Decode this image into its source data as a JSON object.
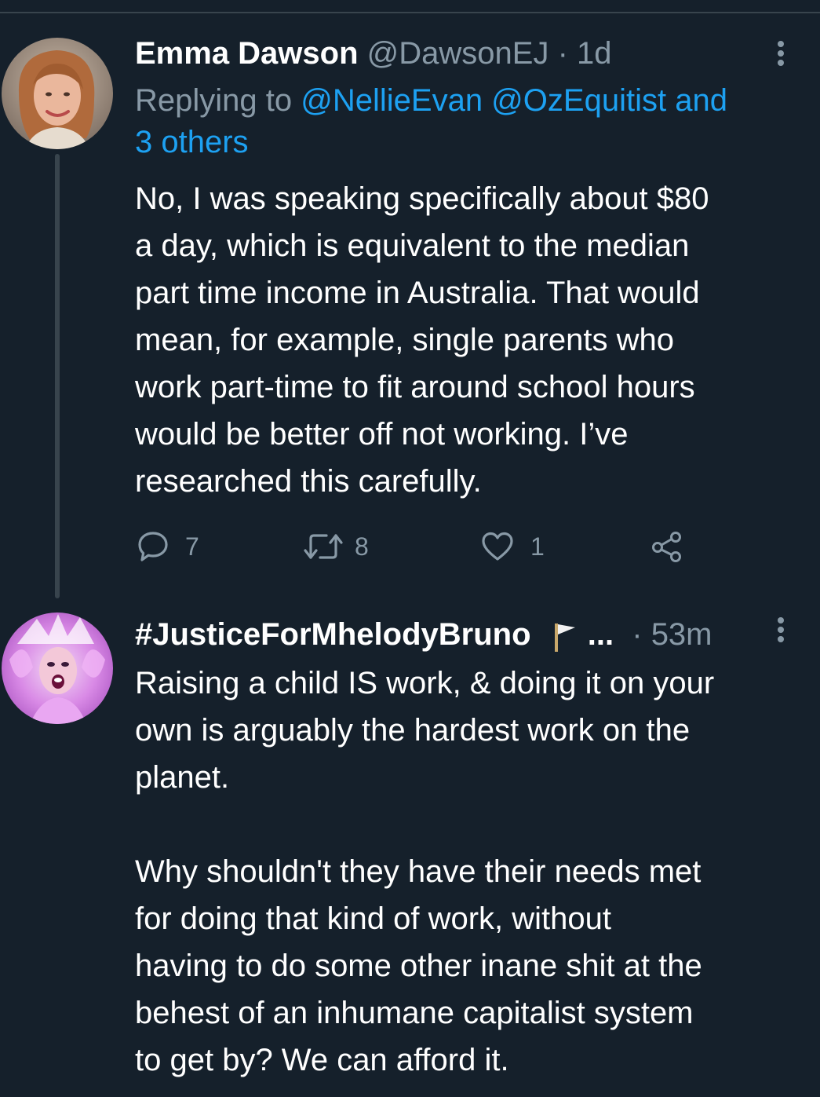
{
  "tweet1": {
    "display_name": "Emma Dawson",
    "handle": "@DawsonEJ",
    "separator": "·",
    "time": "1d",
    "replying_prefix": "Replying to",
    "replying_mentions": "@NellieEvan @OzEquitist",
    "replying_and": "and",
    "replying_others": "3 others",
    "lines": [
      "No, I was speaking specifically about $80",
      "a day, which is equivalent to the median",
      "part time income in Australia. That would",
      "mean, for example, single parents who",
      "work part-time to fit around school hours",
      "would be better off not working. I’ve",
      "researched this carefully."
    ],
    "reply_count": "7",
    "retweet_count": "8",
    "like_count": "1"
  },
  "tweet2": {
    "display_name": "#JusticeForMhelodyBruno",
    "ellipsis": "...",
    "separator": "·",
    "time": "53m",
    "lines": [
      "Raising a child IS work, & doing it on your",
      "own is arguably the hardest work on the",
      "planet.",
      "",
      "Why shouldn't they have their needs met",
      "for doing that kind of work, without",
      "having to do some other inane shit at the",
      "behest of an inhumane capitalist system",
      "to get by? We can afford it."
    ]
  },
  "colors": {
    "background": "#15202b",
    "text": "#ffffff",
    "muted": "#8899a6",
    "link": "#1da1f2",
    "divider": "#38444d"
  },
  "icons": {
    "reply": "comment-bubble-icon",
    "retweet": "retweet-icon",
    "like": "heart-icon",
    "share": "share-icon",
    "more": "more-vertical-icon",
    "flag": "white-flag-icon"
  }
}
